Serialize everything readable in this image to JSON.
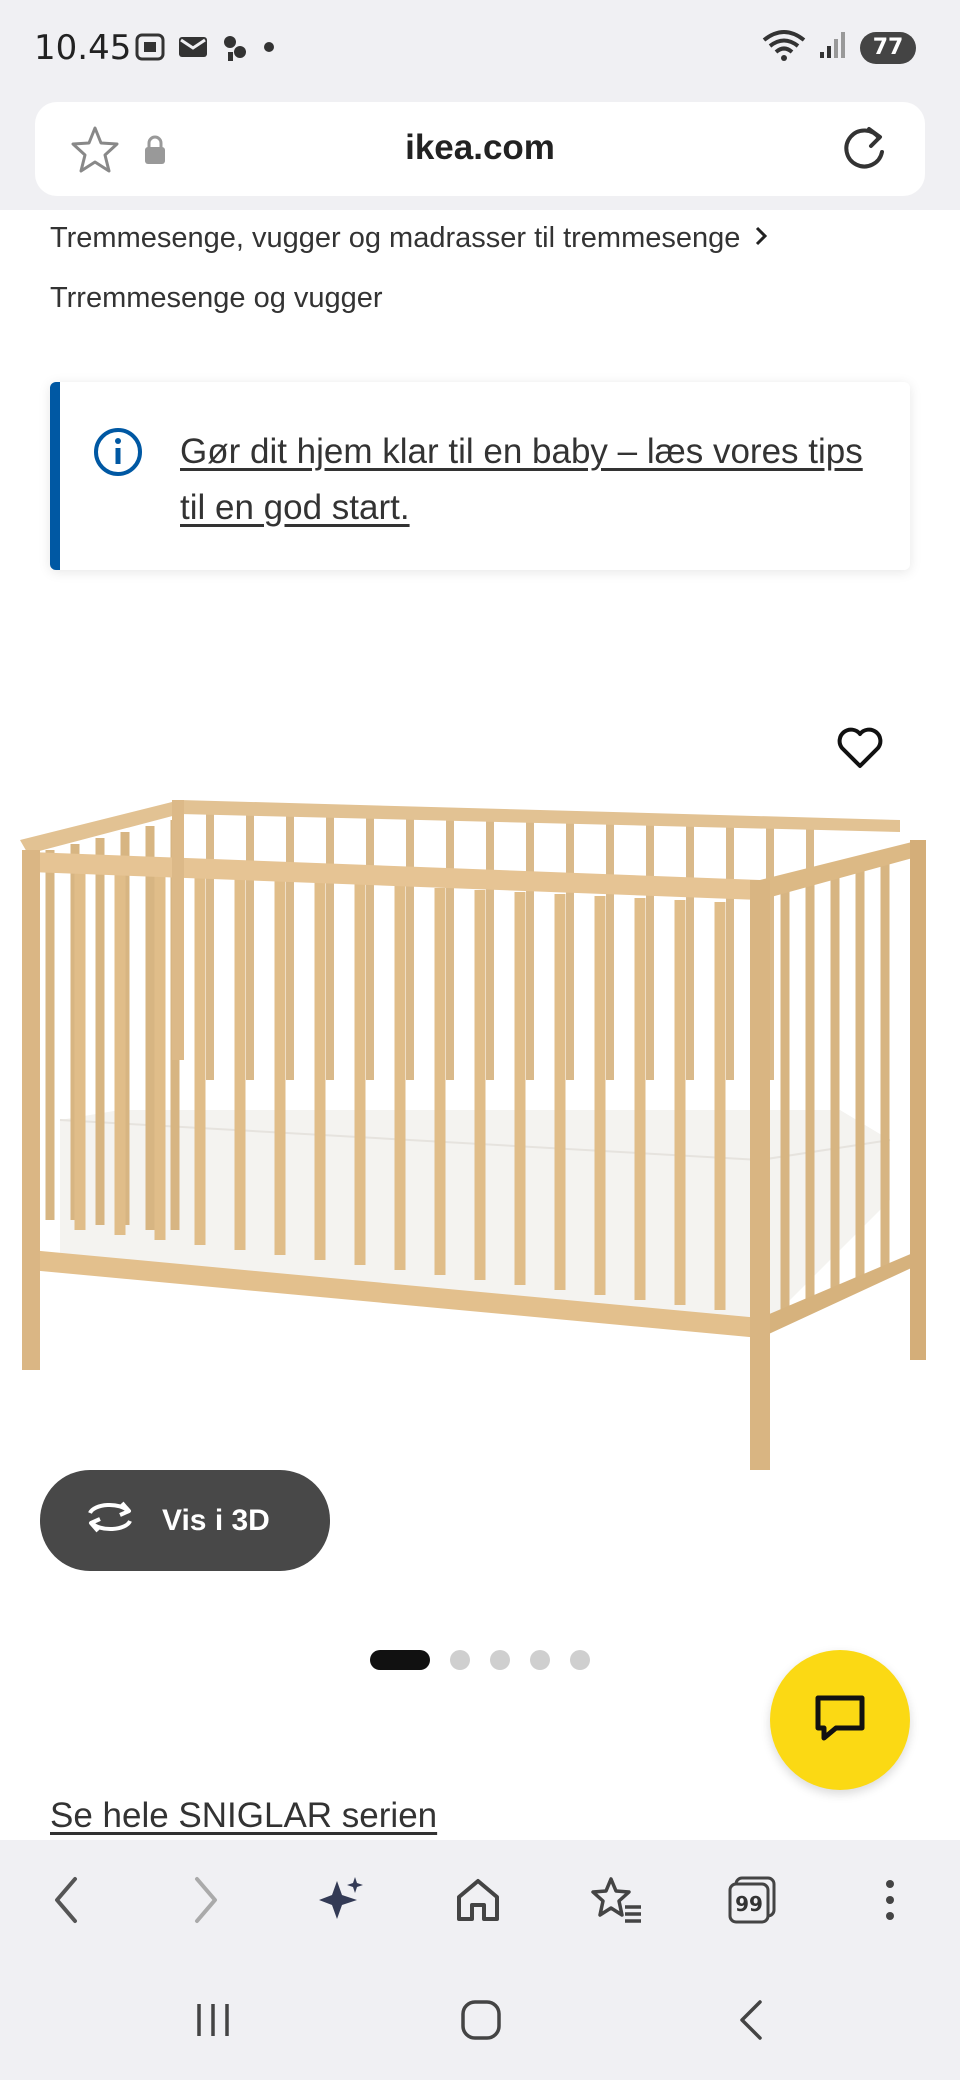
{
  "status_bar": {
    "time": "10.45",
    "battery": "77",
    "icons": [
      "screenshot-icon",
      "mail-icon",
      "signal-app-icon",
      "dot-icon",
      "wifi-icon",
      "cell-signal-icon",
      "battery-icon"
    ]
  },
  "url_bar": {
    "domain": "ikea.com",
    "icons": [
      "star-icon",
      "lock-icon",
      "reload-icon"
    ]
  },
  "breadcrumb": {
    "item1": "Tremmesenge, vugger og madrasser til tremmesenge",
    "item2": "Trremmesenge og vugger"
  },
  "info_box": {
    "text": "Gør dit hjem klar til en baby – læs vores tips til en god start.",
    "accent_color": "#0058a3"
  },
  "product": {
    "image_alt": "SNIGLAR crib",
    "vis3d_label": "Vis i 3D",
    "carousel": {
      "count": 5,
      "active": 1
    },
    "series_link": "Se hele SNIGLAR serien"
  },
  "chat_fab": {
    "color": "#fbd914",
    "icon": "chat-icon"
  },
  "toolbar": {
    "buttons": [
      "back-icon",
      "forward-icon",
      "sparkle-icon",
      "home-icon",
      "bookmarks-icon",
      "tabs-icon",
      "more-icon"
    ],
    "tabs_count": "99"
  },
  "system_nav": {
    "buttons": [
      "recents-icon",
      "home-icon",
      "back-icon"
    ]
  }
}
